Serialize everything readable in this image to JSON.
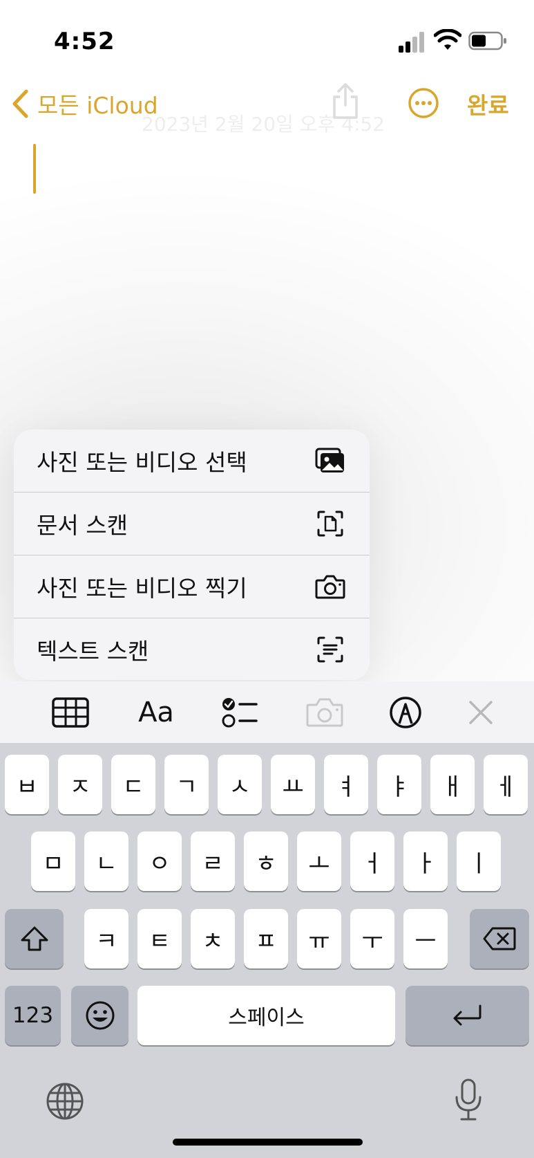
{
  "status_bar": {
    "time": "4:52"
  },
  "nav": {
    "back_label": "모든 iCloud",
    "done_label": "완료",
    "faded_date": "2023년 2월 20일 오후 4:52"
  },
  "menu": {
    "items": [
      {
        "label": "사진 또는 비디오 선택",
        "icon": "photo-library-icon"
      },
      {
        "label": "문서 스캔",
        "icon": "doc-scan-icon"
      },
      {
        "label": "사진 또는 비디오 찍기",
        "icon": "camera-icon"
      },
      {
        "label": "텍스트 스캔",
        "icon": "text-scan-icon"
      }
    ]
  },
  "toolbar": {
    "items": [
      "table-icon",
      "text-format-icon",
      "checklist-icon",
      "camera-icon",
      "markup-icon",
      "close-icon"
    ],
    "text_format_label": "Aa"
  },
  "keyboard": {
    "row1": [
      "ㅂ",
      "ㅈ",
      "ㄷ",
      "ㄱ",
      "ㅅ",
      "ㅛ",
      "ㅕ",
      "ㅑ",
      "ㅐ",
      "ㅔ"
    ],
    "row2": [
      "ㅁ",
      "ㄴ",
      "ㅇ",
      "ㄹ",
      "ㅎ",
      "ㅗ",
      "ㅓ",
      "ㅏ",
      "ㅣ"
    ],
    "row3": [
      "ㅋ",
      "ㅌ",
      "ㅊ",
      "ㅍ",
      "ㅠ",
      "ㅜ",
      "ㅡ"
    ],
    "numbers_label": "123",
    "space_label": "스페이스"
  },
  "colors": {
    "accent": "#d9a62c",
    "keyboard_bg": "#d1d3d9",
    "key": "#ffffff",
    "key_dark": "#abb0ba"
  }
}
